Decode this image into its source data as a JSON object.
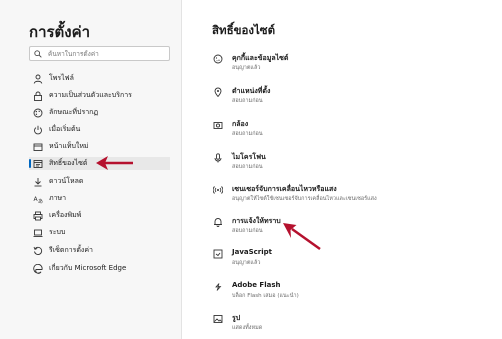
{
  "sidebar": {
    "title": "การตั้งค่า",
    "search_placeholder": "ค้นหาในการตั้งค่า",
    "items": [
      {
        "label": "โพรไฟล์",
        "icon": "person-icon"
      },
      {
        "label": "ความเป็นส่วนตัวและบริการ",
        "icon": "lock-icon"
      },
      {
        "label": "ลักษณะที่ปรากฏ",
        "icon": "palette-icon"
      },
      {
        "label": "เมื่อเริ่มต้น",
        "icon": "power-icon"
      },
      {
        "label": "หน้าแท็บใหม่",
        "icon": "new-tab-icon"
      },
      {
        "label": "สิทธิ์ของไซต์",
        "icon": "site-permissions-icon",
        "selected": true
      },
      {
        "label": "ดาวน์โหลด",
        "icon": "download-icon"
      },
      {
        "label": "ภาษา",
        "icon": "language-icon"
      },
      {
        "label": "เครื่องพิมพ์",
        "icon": "printer-icon"
      },
      {
        "label": "ระบบ",
        "icon": "computer-icon"
      },
      {
        "label": "รีเซ็ตการตั้งค่า",
        "icon": "reset-icon"
      },
      {
        "label": "เกี่ยวกับ Microsoft Edge",
        "icon": "edge-logo-icon"
      }
    ]
  },
  "main": {
    "title": "สิทธิ์ของไซต์",
    "permissions": [
      {
        "name": "คุกกี้และข้อมูลไซต์",
        "status": "อนุญาตแล้ว",
        "icon": "cookie-icon"
      },
      {
        "name": "ตำแหน่งที่ตั้ง",
        "status": "สอบถามก่อน",
        "icon": "location-pin-icon"
      },
      {
        "name": "กล้อง",
        "status": "สอบถามก่อน",
        "icon": "camera-icon"
      },
      {
        "name": "ไมโครโฟน",
        "status": "สอบถามก่อน",
        "icon": "microphone-icon"
      },
      {
        "name": "เซนเซอร์จับการเคลื่อนไหวหรือแสง",
        "status": "อนุญาตให้ไซต์ใช้เซนเซอร์จับการเคลื่อนไหวและเซนเซอร์แสง",
        "icon": "motion-sensor-icon"
      },
      {
        "name": "การแจ้งให้ทราบ",
        "status": "สอบถามก่อน",
        "icon": "bell-icon"
      },
      {
        "name": "JavaScript",
        "status": "อนุญาตแล้ว",
        "icon": "javascript-icon"
      },
      {
        "name": "Adobe Flash",
        "status": "บล็อก Flash เสมอ (แนะนำ)",
        "icon": "puzzle-icon"
      },
      {
        "name": "รูป",
        "status": "แสดงทั้งหมด",
        "icon": "image-icon"
      }
    ]
  },
  "colors": {
    "arrow": "#b5112e",
    "selected_bar": "#0067c0"
  }
}
